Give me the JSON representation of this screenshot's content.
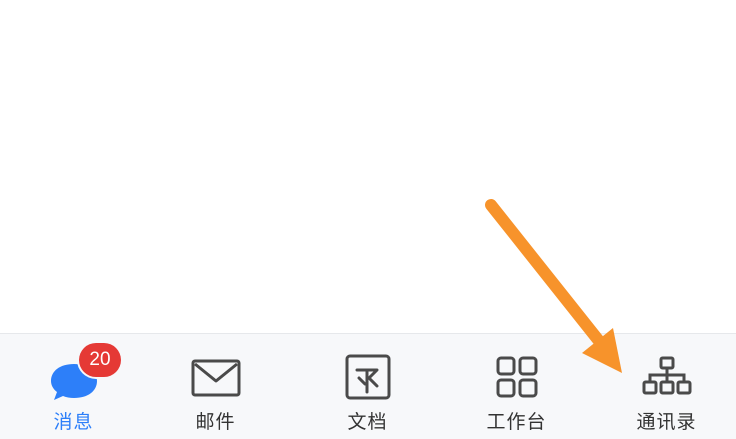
{
  "tabbar": {
    "tabs": [
      {
        "label": "消息",
        "icon": "chat-bubble-icon",
        "active": true,
        "badge": "20"
      },
      {
        "label": "邮件",
        "icon": "mail-envelope-icon",
        "active": false
      },
      {
        "label": "文档",
        "icon": "document-icon",
        "active": false
      },
      {
        "label": "工作台",
        "icon": "workbench-grid-icon",
        "active": false
      },
      {
        "label": "通讯录",
        "icon": "org-chart-icon",
        "active": false
      }
    ]
  },
  "annotation": {
    "icon": "orange-arrow-icon",
    "color": "#f7932b"
  },
  "colors": {
    "active": "#2d7ff9",
    "inactive_icon": "#4a4a4a",
    "badge": "#e53935"
  }
}
